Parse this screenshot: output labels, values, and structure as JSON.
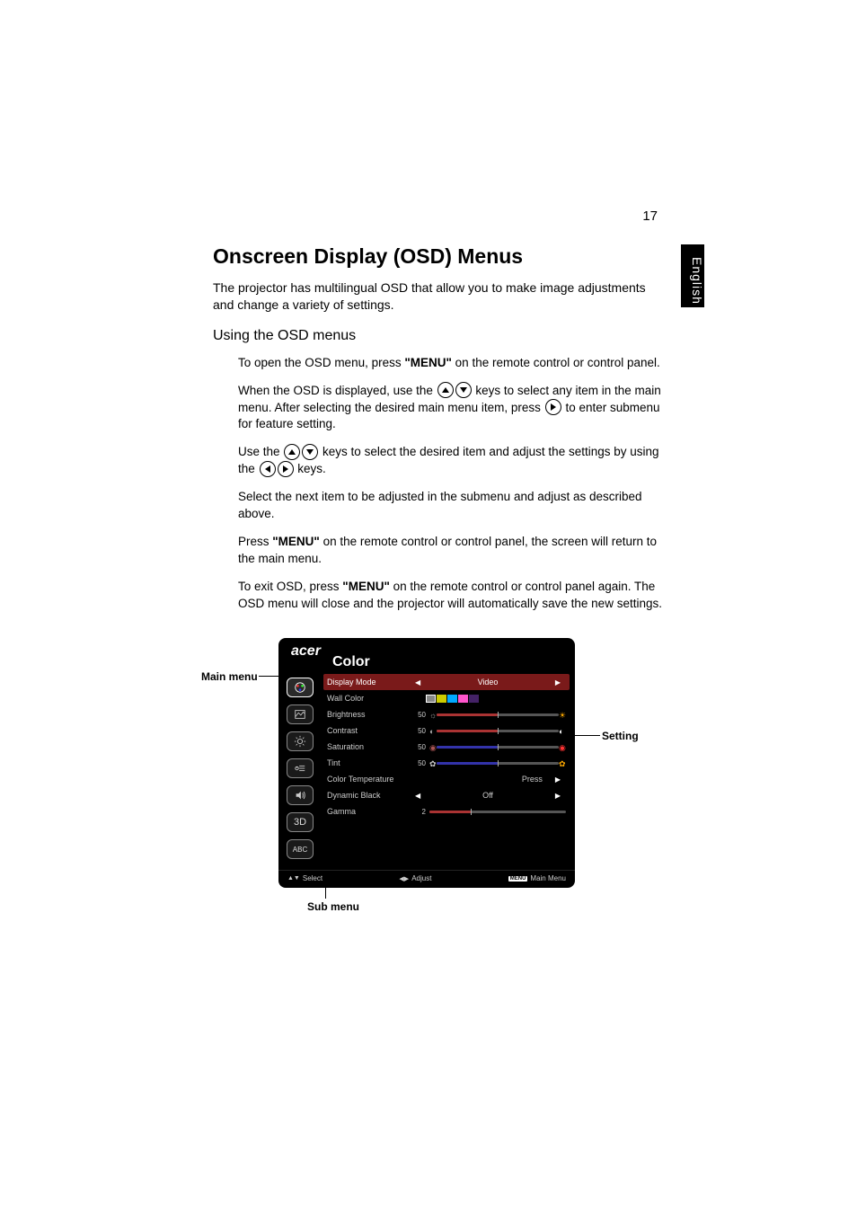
{
  "page_number": "17",
  "side_tab": "English",
  "heading": "Onscreen Display (OSD) Menus",
  "intro": "The projector has multilingual OSD that allow you to make image adjustments and change a variety of settings.",
  "subheading": "Using the OSD menus",
  "bullets": {
    "b1_a": "To open the OSD menu, press ",
    "b1_menu": "\"MENU\"",
    "b1_b": " on the remote control or control panel.",
    "b2_a": "When the OSD is displayed, use the ",
    "b2_b": " keys to select any item in the main menu. After selecting the desired main menu item, press ",
    "b2_c": " to enter submenu for feature setting.",
    "b3_a": "Use the ",
    "b3_b": " keys to select the desired item and adjust the settings by using the ",
    "b3_c": " keys.",
    "b4": "Select the next item to be adjusted in the submenu and adjust as described above.",
    "b5_a": "Press ",
    "b5_menu": "\"MENU\"",
    "b5_b": " on the remote control or control panel, the screen will return to the main menu.",
    "b6_a": "To exit OSD, press ",
    "b6_menu": "\"MENU\"",
    "b6_b": " on the remote control or control panel again. The OSD menu will close and the projector will automatically save the new settings."
  },
  "osd": {
    "logo": "acer",
    "title": "Color",
    "rows": {
      "display_mode": {
        "label": "Display Mode",
        "value": "Video"
      },
      "wall_color": {
        "label": "Wall Color"
      },
      "brightness": {
        "label": "Brightness",
        "val": "50"
      },
      "contrast": {
        "label": "Contrast",
        "val": "50"
      },
      "saturation": {
        "label": "Saturation",
        "val": "50"
      },
      "tint": {
        "label": "Tint",
        "val": "50"
      },
      "color_temp": {
        "label": "Color Temperature",
        "value": "Press"
      },
      "dynamic_black": {
        "label": "Dynamic Black",
        "value": "Off"
      },
      "gamma": {
        "label": "Gamma",
        "val": "2"
      }
    },
    "footer": {
      "select": "Select",
      "adjust": "Adjust",
      "menu_badge": "MENU",
      "main_menu": "Main Menu"
    },
    "sidebar_3d": "3D",
    "sidebar_abc": "ABC"
  },
  "callouts": {
    "main_menu": "Main menu",
    "sub_menu": "Sub menu",
    "setting": "Setting"
  }
}
